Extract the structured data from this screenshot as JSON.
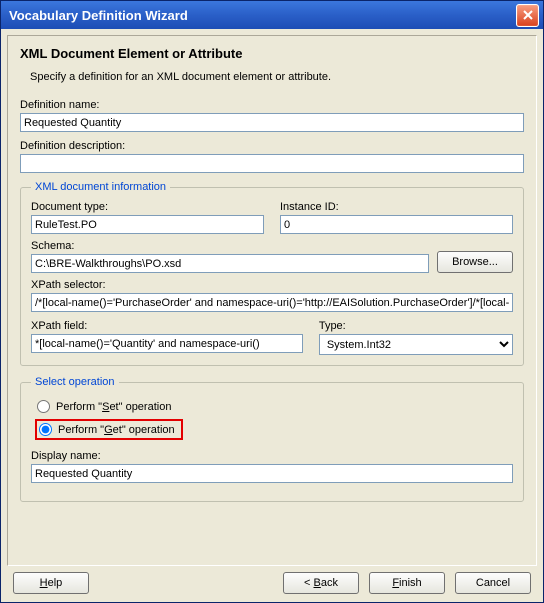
{
  "window": {
    "title": "Vocabulary Definition Wizard"
  },
  "header": {
    "title": "XML Document Element or Attribute",
    "intro": "Specify a definition for an XML document element or attribute."
  },
  "definition": {
    "name_label": "Definition name:",
    "name_value": "Requested Quantity",
    "desc_label": "Definition description:",
    "desc_value": ""
  },
  "xmlinfo": {
    "legend": "XML document information",
    "doc_type_label": "Document type:",
    "doc_type_value": "RuleTest.PO",
    "instance_label": "Instance ID:",
    "instance_value": "0",
    "schema_label": "Schema:",
    "schema_value": "C:\\BRE-Walkthroughs\\PO.xsd",
    "browse_label": "Browse...",
    "xpath_sel_label": "XPath selector:",
    "xpath_sel_value": "/*[local-name()='PurchaseOrder' and namespace-uri()='http://EAISolution.PurchaseOrder']/*[local-n",
    "xpath_field_label": "XPath field:",
    "xpath_field_value": "*[local-name()='Quantity' and namespace-uri()",
    "type_label": "Type:",
    "type_value": "System.Int32"
  },
  "operation": {
    "legend": "Select operation",
    "set_prefix": "Perform \"",
    "set_key": "S",
    "set_suffix": "et\" operation",
    "get_prefix": "Perform \"",
    "get_key": "G",
    "get_suffix": "et\" operation",
    "display_label": "Display name:",
    "display_value": "Requested Quantity"
  },
  "buttons": {
    "help_key": "H",
    "help_rest": "elp",
    "back_prefix": "< ",
    "back_key": "B",
    "back_rest": "ack",
    "finish_key": "F",
    "finish_rest": "inish",
    "cancel": "Cancel"
  }
}
